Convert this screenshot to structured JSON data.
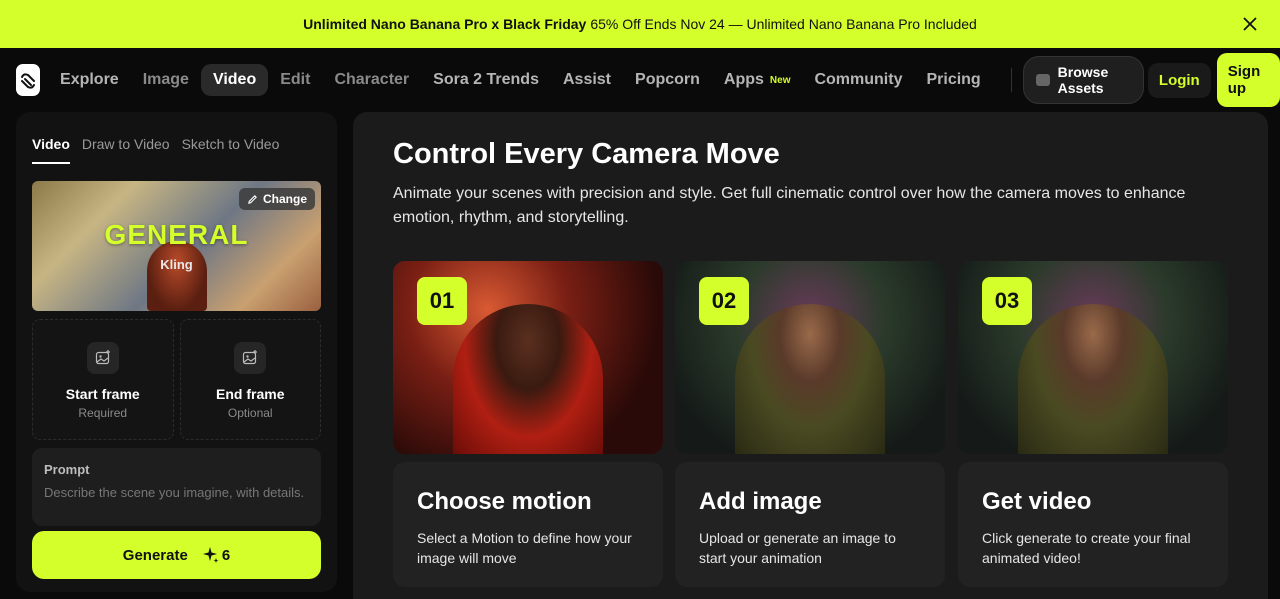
{
  "banner": {
    "bold_text": "Unlimited Nano Banana Pro x Black Friday",
    "text": "65% Off Ends Nov 24 — Unlimited Nano Banana Pro Included"
  },
  "nav": {
    "items": [
      {
        "label": "Explore"
      },
      {
        "label": "Image"
      },
      {
        "label": "Video"
      },
      {
        "label": "Edit"
      },
      {
        "label": "Character"
      },
      {
        "label": "Sora 2 Trends"
      },
      {
        "label": "Assist"
      },
      {
        "label": "Popcorn"
      },
      {
        "label": "Apps",
        "badge": "New"
      },
      {
        "label": "Community"
      },
      {
        "label": "Pricing"
      }
    ],
    "browse_assets": "Browse Assets",
    "login": "Login",
    "signup": "Sign up"
  },
  "left_panel": {
    "tabs": [
      "Video",
      "Draw to Video",
      "Sketch to Video"
    ],
    "model": {
      "title": "GENERAL",
      "subtitle": "Kling",
      "change_label": "Change"
    },
    "start_frame": {
      "label": "Start frame",
      "sub": "Required"
    },
    "end_frame": {
      "label": "End frame",
      "sub": "Optional"
    },
    "prompt": {
      "label": "Prompt",
      "placeholder": "Describe the scene you imagine, with details."
    },
    "generate": {
      "label": "Generate",
      "credits": "6"
    }
  },
  "main": {
    "title": "Control Every Camera Move",
    "description": "Animate your scenes with precision and style. Get full cinematic control over how the camera moves to enhance emotion, rhythm, and storytelling.",
    "steps": [
      {
        "number": "01",
        "title": "Choose motion",
        "desc": "Select a Motion to define how your image will move"
      },
      {
        "number": "02",
        "title": "Add image",
        "desc": "Upload or generate an image to start your animation"
      },
      {
        "number": "03",
        "title": "Get video",
        "desc": "Click generate to create your final animated video!"
      }
    ]
  },
  "colors": {
    "accent": "#d4ff2a",
    "background": "#0a0a0a",
    "panel": "#121212",
    "main_panel": "#1b1b1b"
  }
}
